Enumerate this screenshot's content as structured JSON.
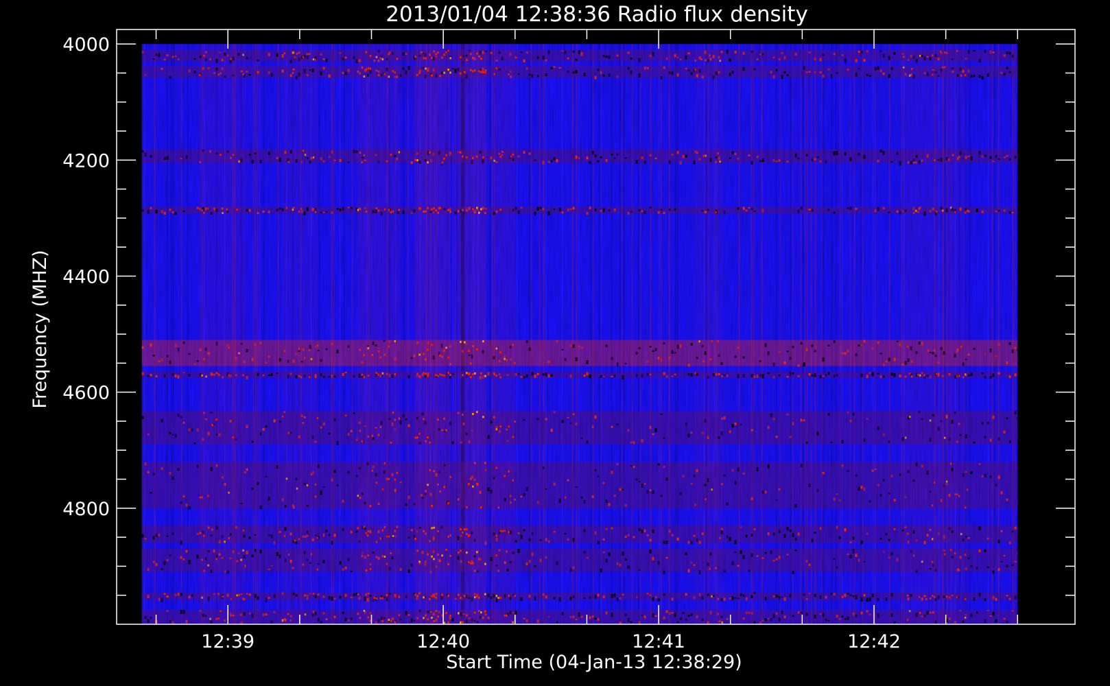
{
  "colors": {
    "background": "#000000",
    "axis": "#ffffff",
    "text": "#ffffff",
    "spectrum_base": "#1a10f0",
    "emission_red": "#ff2a00",
    "emission_black": "#000000"
  },
  "chart_data": {
    "type": "heatmap",
    "title": "2013/01/04 12:38:36 Radio flux density",
    "xlabel": "Start Time (04-Jan-13 12:38:29)",
    "ylabel": "Frequency (MHZ)",
    "x_axis": {
      "unit": "time",
      "range": [
        "12:38:29",
        "12:42:56"
      ],
      "data_range": [
        "12:38:36",
        "12:42:40"
      ],
      "major_ticks": [
        {
          "label": "12:39",
          "value": "12:39:00"
        },
        {
          "label": "12:40",
          "value": "12:40:00"
        },
        {
          "label": "12:41",
          "value": "12:41:00"
        },
        {
          "label": "12:42",
          "value": "12:42:00"
        }
      ],
      "minor_ticks": [
        "12:38:40",
        "12:39:20",
        "12:39:40",
        "12:40:20",
        "12:40:40",
        "12:41:20",
        "12:41:40",
        "12:42:20",
        "12:42:40"
      ]
    },
    "y_axis": {
      "unit": "MHz",
      "range": [
        3975,
        5000
      ],
      "inverted": true,
      "data_range": [
        4000,
        5000
      ],
      "major_ticks": [
        {
          "label": "4000",
          "value": 4000
        },
        {
          "label": "4200",
          "value": 4200
        },
        {
          "label": "4400",
          "value": 4400
        },
        {
          "label": "4600",
          "value": 4600
        },
        {
          "label": "4800",
          "value": 4800
        }
      ],
      "minor_ticks": [
        4050,
        4100,
        4150,
        4250,
        4300,
        4350,
        4450,
        4500,
        4550,
        4650,
        4700,
        4750,
        4850,
        4900,
        4950
      ]
    },
    "grid": false,
    "legend": "none",
    "horizontal_bands": [
      {
        "from": 4010,
        "to": 4030,
        "level": "mixed"
      },
      {
        "from": 4038,
        "to": 4058,
        "level": "mixed"
      },
      {
        "from": 4182,
        "to": 4205,
        "level": "mixed"
      },
      {
        "from": 4280,
        "to": 4292,
        "level": "mixed"
      },
      {
        "from": 4510,
        "to": 4555,
        "level": "red"
      },
      {
        "from": 4565,
        "to": 4575,
        "level": "mixed"
      },
      {
        "from": 4632,
        "to": 4690,
        "level": "mixed"
      },
      {
        "from": 4720,
        "to": 4800,
        "level": "mixed"
      },
      {
        "from": 4830,
        "to": 4860,
        "level": "mixed"
      },
      {
        "from": 4870,
        "to": 4910,
        "level": "mixed"
      },
      {
        "from": 4945,
        "to": 4958,
        "level": "mixed"
      },
      {
        "from": 4975,
        "to": 4998,
        "level": "mixed"
      }
    ],
    "burst_intervals": [
      {
        "from": "12:38:52",
        "to": "12:39:05",
        "intensity": 0.5
      },
      {
        "from": "12:39:15",
        "to": "12:39:25",
        "intensity": 0.45
      },
      {
        "from": "12:39:36",
        "to": "12:39:48",
        "intensity": 0.7
      },
      {
        "from": "12:39:52",
        "to": "12:40:02",
        "intensity": 0.9
      },
      {
        "from": "12:40:04",
        "to": "12:40:12",
        "intensity": 1.0
      },
      {
        "from": "12:40:14",
        "to": "12:40:20",
        "intensity": 0.65
      },
      {
        "from": "12:41:10",
        "to": "12:41:18",
        "intensity": 0.4
      },
      {
        "from": "12:42:08",
        "to": "12:42:26",
        "intensity": 0.45
      }
    ]
  }
}
